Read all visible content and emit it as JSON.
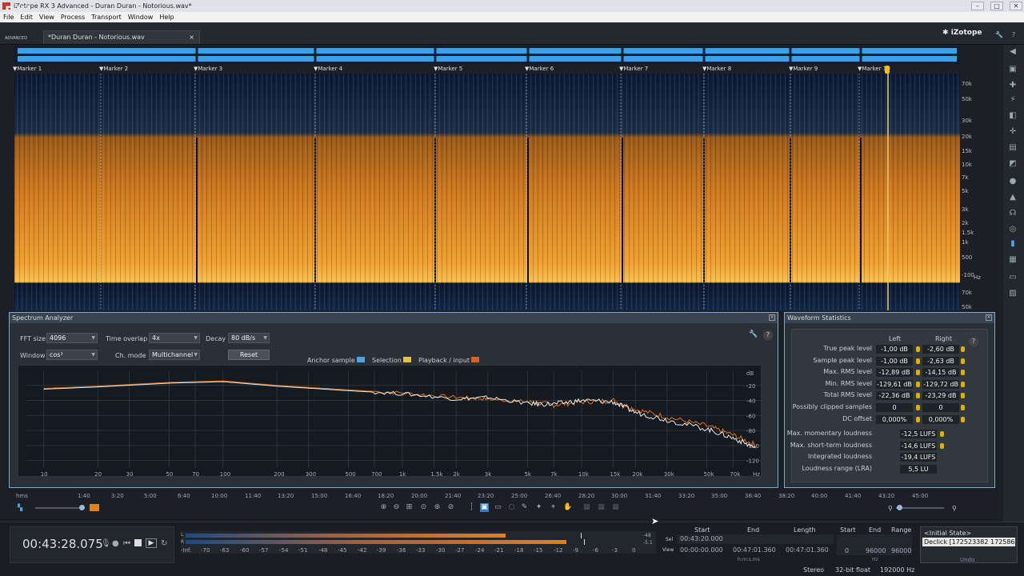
{
  "window": {
    "title": "iZotope RX 3 Advanced - Duran Duran - Notorious.wav*"
  },
  "menu": [
    "File",
    "Edit",
    "View",
    "Process",
    "Transport",
    "Window",
    "Help"
  ],
  "logo": {
    "text": "RX",
    "version": "3",
    "sub": "ADVANCED"
  },
  "tab": {
    "label": "*Duran Duran - Notorious.wav",
    "close": "×"
  },
  "brand": "iZotope",
  "markers": [
    "Marker 1",
    "Marker 2",
    "Marker 3",
    "Marker 4",
    "Marker 5",
    "Marker 6",
    "Marker 7",
    "Marker 8",
    "Marker 9",
    "Marker 10"
  ],
  "freq_labels": [
    "70k",
    "50k",
    "30k",
    "20k",
    "15k",
    "10k",
    "7k",
    "5k",
    "3k",
    "2k",
    "1.5k",
    "1k",
    "500",
    "-100",
    "70k",
    "50k"
  ],
  "freq_unit": "Hz",
  "spectrum_analyzer": {
    "title": "Spectrum Analyzer",
    "fft_label": "FFT size",
    "fft_value": "4096",
    "overlap_label": "Time overlap",
    "overlap_value": "4x",
    "decay_label": "Decay",
    "decay_value": "80 dB/s",
    "window_label": "Window",
    "window_value": "cos³",
    "chmode_label": "Ch. mode",
    "chmode_value": "Multichannel",
    "reset_label": "Reset",
    "legend": [
      "Anchor sample",
      "Selection",
      "Playback / input"
    ],
    "colors": {
      "anchor": "#4fa3e0",
      "selection": "#e8c040",
      "playback": "#e06020"
    }
  },
  "chart_data": {
    "type": "line",
    "xlabel": "Hz",
    "ylabel": "dB",
    "x_ticks": [
      "10",
      "20",
      "30",
      "50",
      "70",
      "100",
      "200",
      "300",
      "500",
      "700",
      "1k",
      "1.5k",
      "2k",
      "3k",
      "5k",
      "7k",
      "10k",
      "15k",
      "20k",
      "30k",
      "50k",
      "70k",
      "Hz"
    ],
    "y_ticks": [
      "dB",
      "-20",
      "-40",
      "-60",
      "-80",
      "-100",
      "-120"
    ],
    "ylim": [
      -130,
      0
    ],
    "series": [
      {
        "name": "Playback / input",
        "color": "#e0701a",
        "x": [
          10,
          20,
          50,
          100,
          200,
          500,
          1000,
          2000,
          3000,
          5000,
          7000,
          10000,
          15000,
          20000,
          30000,
          50000,
          70000,
          95000
        ],
        "y": [
          -24,
          -21,
          -16,
          -14,
          -20,
          -26,
          -30,
          -36,
          -38,
          -42,
          -46,
          -42,
          -40,
          -52,
          -62,
          -74,
          -86,
          -100
        ]
      },
      {
        "name": "Selection",
        "color": "#e8e8e8",
        "x": [
          10,
          20,
          50,
          100,
          200,
          500,
          1000,
          2000,
          3000,
          5000,
          7000,
          10000,
          15000,
          20000,
          30000,
          50000,
          70000,
          95000
        ],
        "y": [
          -25,
          -22,
          -17,
          -15,
          -21,
          -27,
          -31,
          -38,
          -36,
          -44,
          -45,
          -40,
          -42,
          -56,
          -66,
          -78,
          -90,
          -104
        ]
      }
    ]
  },
  "waveform_statistics": {
    "title": "Waveform Statistics",
    "col_left": "Left",
    "col_right": "Right",
    "rows": [
      {
        "label": "True peak level",
        "left": "-1,00 dB",
        "right": "-2,60 dB"
      },
      {
        "label": "Sample peak level",
        "left": "-1,00 dB",
        "right": "-2,63 dB"
      },
      {
        "label": "Max. RMS level",
        "left": "-12,89 dB",
        "right": "-14,15 dB"
      },
      {
        "label": "Min. RMS level",
        "left": "-129,61 dB",
        "right": "-129,72 dB"
      },
      {
        "label": "Total RMS level",
        "left": "-22,36 dB",
        "right": "-23,29 dB"
      },
      {
        "label": "Possibly clipped samples",
        "left": "0",
        "right": "0"
      },
      {
        "label": "DC offset",
        "left": "0,000%",
        "right": "0,000%"
      }
    ],
    "loudness": [
      {
        "label": "Max. momentary loudness",
        "value": "-12,5 LUFS"
      },
      {
        "label": "Max. short-term loudness",
        "value": "-14,6 LUFS"
      },
      {
        "label": "Integrated loudness",
        "value": "-19,4 LUFS"
      },
      {
        "label": "Loudness range (LRA)",
        "value": "5,5 LU"
      }
    ]
  },
  "timeline": [
    "hms",
    "1:40",
    "3:20",
    "5:00",
    "6:40",
    "10:00",
    "11:40",
    "13:20",
    "15:00",
    "16:40",
    "18:20",
    "20:00",
    "21:40",
    "23:20",
    "25:00",
    "26:40",
    "28:20",
    "30:00",
    "31:40",
    "33:20",
    "35:00",
    "36:40",
    "38:20",
    "40:00",
    "41:40",
    "43:20",
    "45:00"
  ],
  "transport": {
    "time": "00:43:28.075"
  },
  "meter_labels": [
    "-Inf.",
    "-70",
    "-63",
    "-60",
    "-57",
    "-54",
    "-51",
    "-48",
    "-45",
    "-42",
    "-39",
    "-36",
    "-33",
    "-30",
    "-27",
    "-24",
    "-21",
    "-18",
    "-15",
    "-12",
    "-9",
    "-6",
    "-3",
    "0"
  ],
  "meter_side": {
    "l": "L",
    "r": "R",
    "v1": "-48",
    "v2": "-5.1"
  },
  "selection_info": {
    "headers": [
      "Start",
      "End",
      "Length",
      "Start",
      "End",
      "Range"
    ],
    "sel_label": "Sel",
    "view_label": "View",
    "sel": [
      "00:43:20.000",
      "",
      ""
    ],
    "view": [
      "00:00:00.000",
      "00:47:01.360",
      "00:47:01.360"
    ],
    "freq": [
      "0",
      "96000",
      "96000"
    ],
    "unit_time": "h:m:s.ms",
    "unit_hz": "Hz"
  },
  "history": {
    "title": "<Initial State>",
    "item": "Declick [172523382 1725864:",
    "undo": "Undo"
  },
  "status": [
    "Stereo",
    "32-bit float",
    "192000 Hz"
  ]
}
